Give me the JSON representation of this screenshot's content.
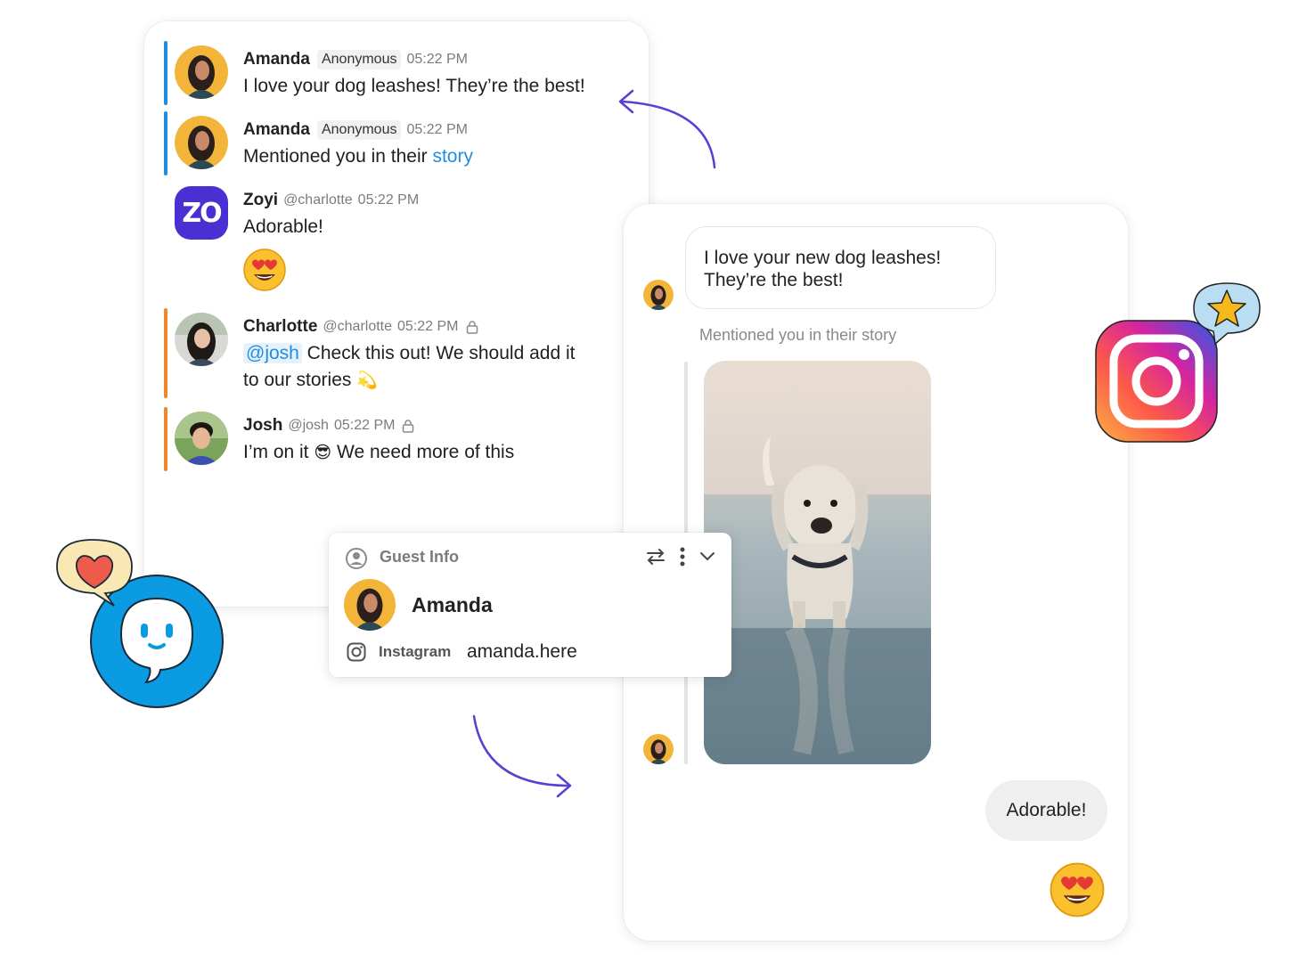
{
  "colors": {
    "accent_blue": "#1d8fe1",
    "accent_orange": "#f0882a",
    "arrow_purple": "#5a3fd6",
    "brand_blue": "#0a9be3"
  },
  "chat": {
    "messages": [
      {
        "name": "Amanda",
        "tag": "Anonymous",
        "time": "05:22 PM",
        "text": "I love your dog leashes! They’re the best!",
        "bar": "blue"
      },
      {
        "name": "Amanda",
        "tag": "Anonymous",
        "time": "05:22 PM",
        "text_prefix": "Mentioned you in their ",
        "text_link": "story",
        "bar": "blue"
      },
      {
        "name": "Zoyi",
        "handle": "@charlotte",
        "time": "05:22 PM",
        "text": "Adorable!",
        "avatar_text": "ZO",
        "emoji": "😍"
      },
      {
        "name": "Charlotte",
        "handle": "@charlotte",
        "time": "05:22 PM",
        "mention": "@josh",
        "text_line1": " Check this out! We should add it",
        "text_line2": "to our stories",
        "emoji": "💫",
        "bar": "orange"
      },
      {
        "name": "Josh",
        "handle": "@josh",
        "time": "05:22 PM",
        "text_a": "I’m on it ",
        "emoji": "😎",
        "text_b": " We need more of this",
        "bar": "orange"
      }
    ]
  },
  "guest_info": {
    "title": "Guest Info",
    "name": "Amanda",
    "channel_label": "Instagram",
    "channel_value": "amanda.here",
    "icons": [
      "user-circle-icon",
      "swap-icon",
      "more-vertical-icon",
      "chevron-down-icon",
      "instagram-outline-icon"
    ]
  },
  "instagram": {
    "incoming_message": "I love your new dog leashes! They’re the best!",
    "mention_text": "Mentioned you in their story",
    "reply": "Adorable!",
    "reply_emoji": "😍"
  }
}
